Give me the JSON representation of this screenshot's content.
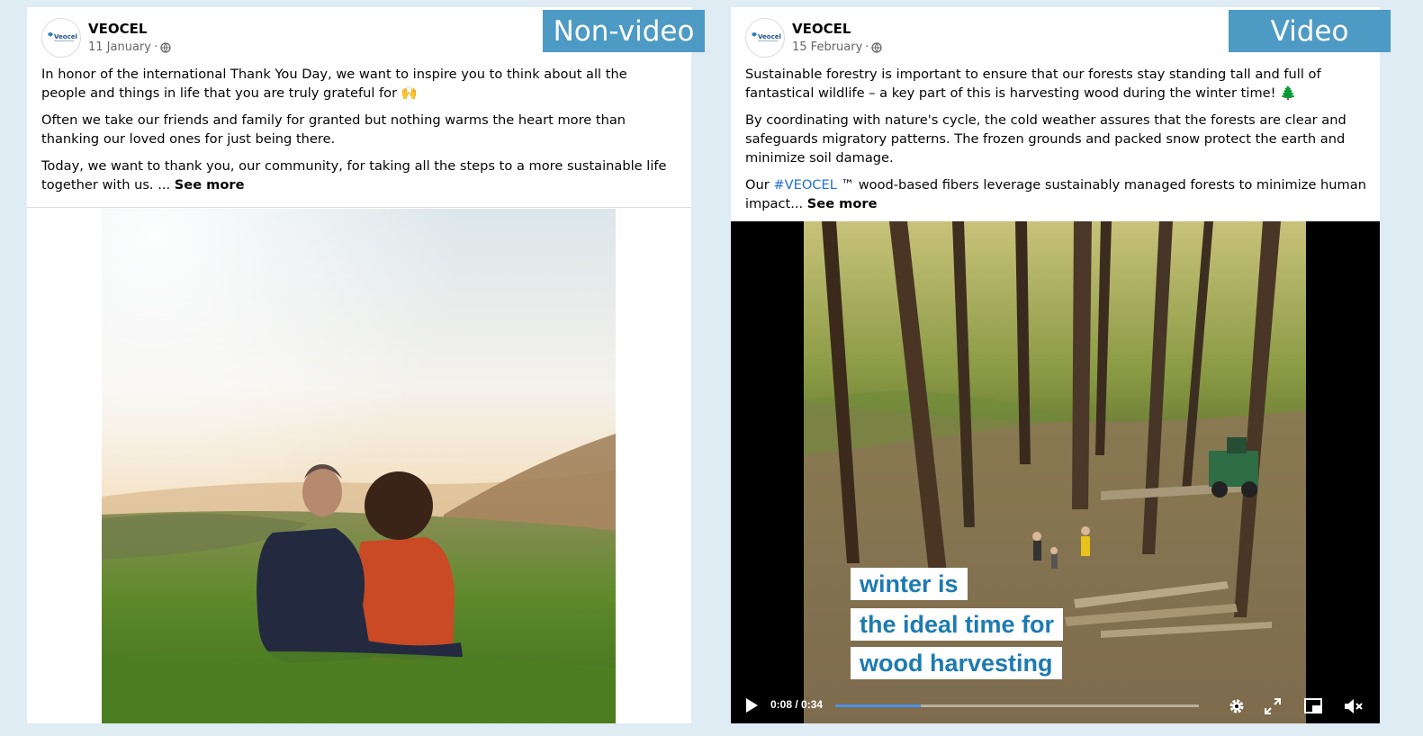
{
  "posts": [
    {
      "author": "VEOCEL",
      "date": "11 January",
      "separator": " · ",
      "label": "Non-video",
      "paragraphs": [
        "In honor of the international Thank You Day, we want to inspire you to think about all the people and things in life that you are truly grateful for 🙌",
        "Often we take our friends and family for granted but nothing warms the heart more than thanking our loved ones for just being there."
      ],
      "last_paragraph": "Today, we want to thank you, our community, for taking all the steps to a more sustainable life together with us. ... ",
      "see_more": "See more",
      "media": "photo-couple-sitting-on-grassy-hill-at-sunrise"
    },
    {
      "author": "VEOCEL",
      "date": "15 February",
      "separator": " · ",
      "label": "Video",
      "paragraphs": [
        "Sustainable forestry is important to ensure that our forests stay standing tall and full of fantastical wildlife – a key part of this is harvesting wood during the winter time! 🌲",
        "By coordinating with nature's cycle, the cold weather assures that the forests are clear and safeguards migratory patterns. The frozen grounds and packed snow protect the earth and minimize soil damage."
      ],
      "last_paragraph_prefix": "Our ",
      "hashtag": "#VEOCEL",
      "last_paragraph_suffix": " ™ wood-based fibers leverage sustainably managed forests to minimize human impact... ",
      "see_more": "See more",
      "media": "video-forest-wood-harvesting",
      "video": {
        "caption_lines": [
          "winter is",
          "the ideal time for",
          "wood harvesting"
        ],
        "time": "0:08 / 0:34",
        "progress": 0.235
      }
    }
  ],
  "avatar_logo_text": "Veocel",
  "icons": {
    "privacy": "globe-icon",
    "play": "play-icon",
    "settings": "gear-icon",
    "fullscreen": "expand-icon",
    "pip": "picture-in-picture-icon",
    "mute": "muted-speaker-icon"
  },
  "colors": {
    "badge": "#4d9ac4",
    "caption_text": "#1d7bb1",
    "hashtag": "#216fdb",
    "progress": "#4b8fe8"
  }
}
